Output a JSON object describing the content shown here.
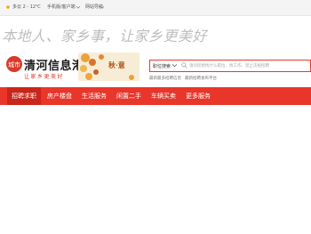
{
  "topbar": {
    "weather": "多云 2 - 12℃",
    "mobile": "手机版/客户端",
    "sitenav": "网站导航"
  },
  "banner": {
    "text": "本地人、家乡事，让家乡更美好"
  },
  "logo": {
    "seal": "城市",
    "name": "清河信息港",
    "slogan": "让家乡更美好"
  },
  "promo": {
    "text": "秋·意"
  },
  "search": {
    "category": "职位搜索",
    "placeholder": "请问您想找什么职位、找工作、禁止违规招聘"
  },
  "hot_links": [
    "最新最多招聘信息",
    "最新招聘发布平台"
  ],
  "nav": {
    "items": [
      {
        "label": "招聘求职"
      },
      {
        "label": "房产楼盘"
      },
      {
        "label": "生活服务"
      },
      {
        "label": "闲置二手"
      },
      {
        "label": "车辆买卖"
      },
      {
        "label": "更多服务"
      }
    ]
  },
  "colors": {
    "accent": "#e8362b",
    "accent_dark": "#c9251a"
  },
  "icons": {
    "weather": "sun-icon",
    "search": "search-icon",
    "dropdown": "chevron-down-icon"
  }
}
